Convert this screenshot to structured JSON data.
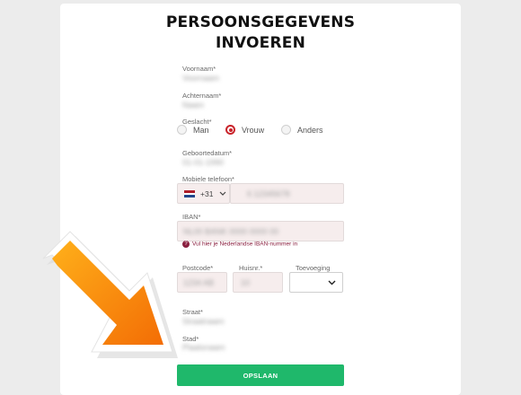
{
  "form": {
    "title_line1": "PERSOONSGEGEVENS",
    "title_line2": "INVOEREN",
    "first_name_label": "Voornaam*",
    "first_name_value": "Voornaam",
    "last_name_label": "Achternaam*",
    "last_name_value": "Naam",
    "gender_label": "Geslacht*",
    "gender_options": [
      "Man",
      "Vrouw",
      "Anders"
    ],
    "gender_selected": "Vrouw",
    "birthdate_label": "Geboortedatum*",
    "birthdate_value": "01-01-1990",
    "phone_label": "Mobiele telefoon*",
    "phone_prefix": "+31",
    "phone_value": "6 12345678",
    "iban_label": "IBAN*",
    "iban_value": "NL00 BANK 0000 0000 00",
    "iban_hint": "Vul hier je Nederlandse IBAN-nummer in",
    "postcode_label": "Postcode*",
    "postcode_value": "1234 AB",
    "housenumber_label": "Huisnr.*",
    "housenumber_value": "10",
    "addition_label": "Toevoeging",
    "street_label": "Straat*",
    "street_value": "Straatnaam",
    "city_label": "Stad*",
    "city_value": "Plaatsnaam",
    "save_label": "OPSLAAN"
  },
  "colors": {
    "accent_red": "#c9242b",
    "save_green": "#1fb86b",
    "hint_purple": "#8a1f3f",
    "arrow_orange": "#f78a0a"
  },
  "icons": {
    "flag": "netherlands-flag-icon",
    "dropdown": "chevron-down-icon",
    "hint": "question-circle-icon",
    "annotation": "orange-arrow"
  }
}
